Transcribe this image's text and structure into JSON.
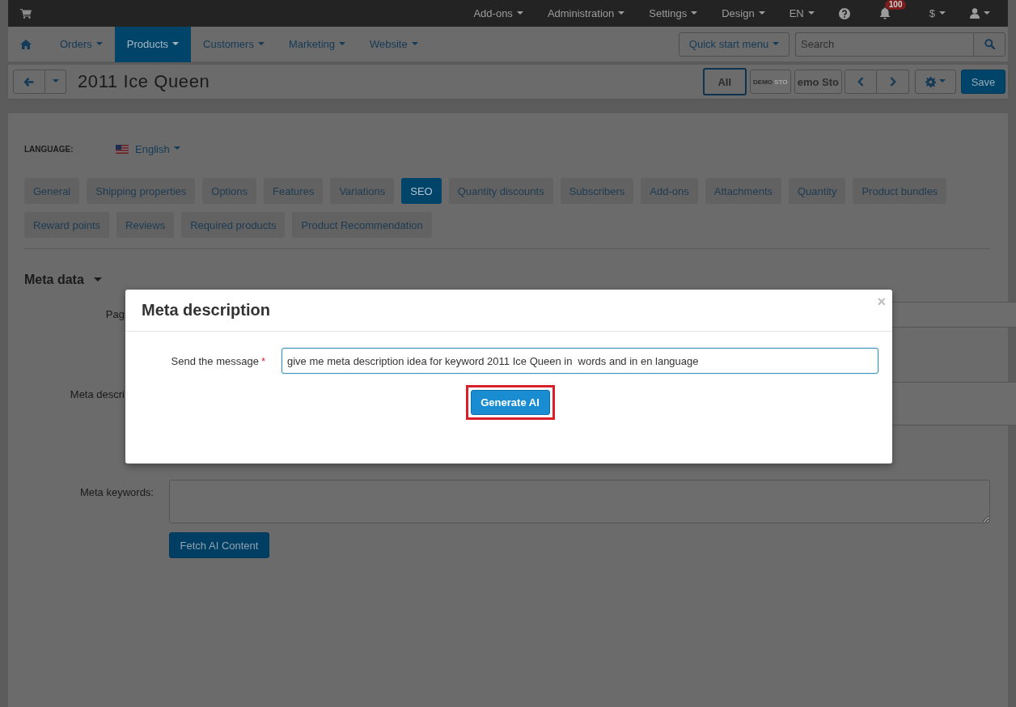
{
  "top_bar": {
    "menus": [
      {
        "label": "Add-ons"
      },
      {
        "label": "Administration"
      },
      {
        "label": "Settings"
      },
      {
        "label": "Design"
      },
      {
        "label": "EN"
      }
    ],
    "notifications": {
      "badge": "100"
    },
    "currency": {
      "label": "$"
    }
  },
  "nav": {
    "items": [
      {
        "label": "Orders",
        "selected": false
      },
      {
        "label": "Products",
        "selected": true
      },
      {
        "label": "Customers",
        "selected": false
      },
      {
        "label": "Marketing",
        "selected": false
      },
      {
        "label": "Website",
        "selected": false
      }
    ],
    "quick_start": {
      "label": "Quick start menu"
    },
    "search": {
      "placeholder": "Search"
    }
  },
  "header": {
    "title": "2011 Ice Queen",
    "storefronts": [
      {
        "kind": "all",
        "label": "All",
        "selected": true
      },
      {
        "kind": "logo",
        "label": "DEMO",
        "tail": "STO",
        "selected": false
      },
      {
        "kind": "name",
        "label": "emo Sto",
        "selected": false
      }
    ],
    "save": {
      "label": "Save"
    }
  },
  "language": {
    "label": "LANGUAGE:",
    "value": "English"
  },
  "tabs": [
    {
      "label": "General",
      "selected": false
    },
    {
      "label": "Shipping properties",
      "selected": false
    },
    {
      "label": "Options",
      "selected": false
    },
    {
      "label": "Features",
      "selected": false
    },
    {
      "label": "Variations",
      "selected": false
    },
    {
      "label": "SEO",
      "selected": true
    },
    {
      "label": "Quantity discounts",
      "selected": false
    },
    {
      "label": "Subscribers",
      "selected": false
    },
    {
      "label": "Add-ons",
      "selected": false
    },
    {
      "label": "Attachments",
      "selected": false
    },
    {
      "label": "Quantity",
      "selected": false
    },
    {
      "label": "Product bundles",
      "selected": false
    },
    {
      "label": "Reward points",
      "selected": false
    },
    {
      "label": "Reviews",
      "selected": false
    },
    {
      "label": "Required products",
      "selected": false
    },
    {
      "label": "Product Recommendation",
      "selected": false
    }
  ],
  "section": {
    "title": "Meta data",
    "expanded": true
  },
  "form": {
    "behind_dialog": [
      {
        "label": "Pag",
        "kind": "input"
      },
      {
        "label": "Meta descri",
        "kind": "textarea"
      }
    ],
    "rows": [
      {
        "label": "Meta keywords:",
        "kind": "textarea"
      }
    ]
  },
  "fetch_button": {
    "label": "Fetch AI Content"
  },
  "dialog": {
    "title": "Meta description",
    "close": "×",
    "field": {
      "label": "Send the message",
      "required_mark": "*",
      "value": "give me meta description idea for keyword 2011 Ice Queen in  words and in en language"
    },
    "button": {
      "label": "Generate AI",
      "highlighted": true
    }
  }
}
